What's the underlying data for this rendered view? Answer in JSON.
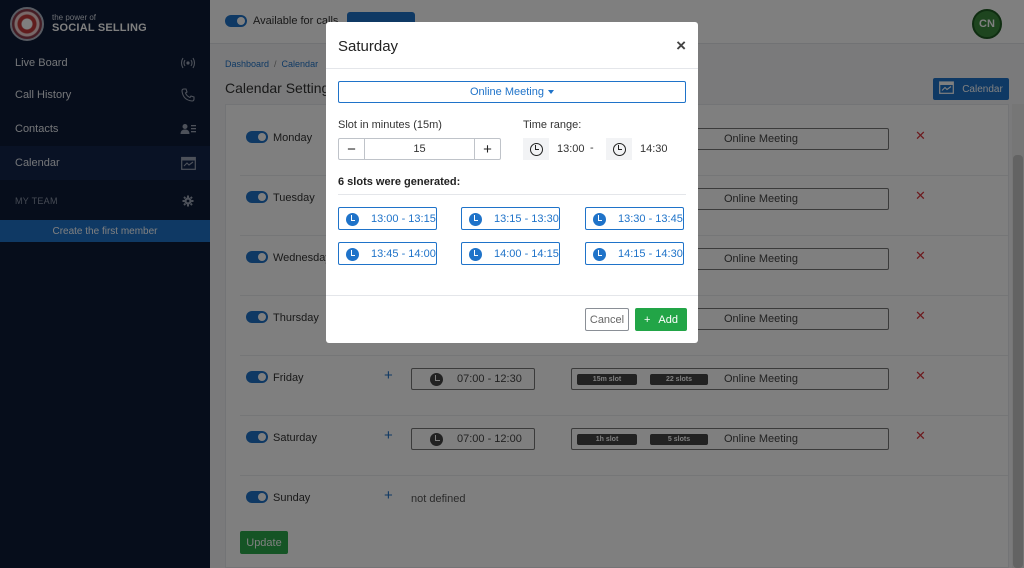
{
  "sidebar": {
    "logo": {
      "small": "the power of",
      "big": "SOCIAL SELLING"
    },
    "items": [
      {
        "label": "Live Board",
        "icon": "broadcast-icon"
      },
      {
        "label": "Call History",
        "icon": "phone-icon"
      },
      {
        "label": "Contacts",
        "icon": "contacts-icon"
      },
      {
        "label": "Calendar",
        "icon": "calendar-icon"
      }
    ],
    "team_heading": "MY TEAM",
    "create_member": "Create the first member"
  },
  "topbar": {
    "available_label": "Available for calls",
    "avatar_initials": "CN"
  },
  "breadcrumb": [
    "Dashboard",
    "Calendar"
  ],
  "page_title": "Calendar Settings",
  "calendar_button": "Calendar",
  "days": [
    {
      "name": "Monday",
      "meeting": "Online Meeting"
    },
    {
      "name": "Tuesday",
      "meeting": "Online Meeting"
    },
    {
      "name": "Wednesday",
      "meeting": "Online Meeting"
    },
    {
      "name": "Thursday",
      "meeting": "Online Meeting"
    },
    {
      "name": "Friday",
      "range": "07:00 - 12:30",
      "slot": "15m slot",
      "count": "22 slots",
      "meeting": "Online Meeting"
    },
    {
      "name": "Saturday",
      "range": "07:00 - 12:00",
      "slot": "1h slot",
      "count": "5 slots",
      "meeting": "Online Meeting"
    },
    {
      "name": "Sunday",
      "status": "not defined"
    }
  ],
  "update_button": "Update",
  "modal": {
    "title": "Saturday",
    "close": "×",
    "type": "Online Meeting",
    "slot_label": "Slot in minutes (15m)",
    "slot_value": "15",
    "range_label": "Time range:",
    "start": "13:00",
    "dash": "-",
    "end": "14:30",
    "generated_title": "6 slots were generated:",
    "slots": [
      "13:00 - 13:15",
      "13:15 - 13:30",
      "13:30 - 13:45",
      "13:45 - 14:00",
      "14:00 - 14:15",
      "14:15 - 14:30"
    ],
    "cancel": "Cancel",
    "add": "Add",
    "add_icon": "+"
  },
  "colors": {
    "primary": "#1f73c9",
    "success": "#22a547",
    "danger": "#d9363e",
    "sidebar": "#0d1b36"
  }
}
